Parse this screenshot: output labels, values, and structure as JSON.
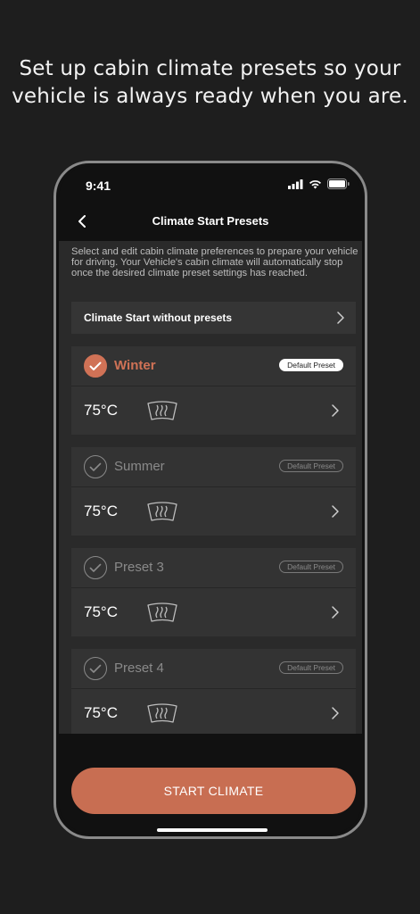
{
  "headline": "Set up cabin climate presets so your vehicle is always ready when you are.",
  "status": {
    "time": "9:41",
    "icons": [
      "signal-icon",
      "wifi-icon",
      "battery-icon"
    ]
  },
  "nav": {
    "title": "Climate Start Presets",
    "back_icon": "chevron-left-icon"
  },
  "intro": "Select and edit cabin climate preferences to prepare your vehicle for driving. Your Vehicle's cabin climate will automatically stop once the desired climate preset settings has reached.",
  "no_presets": {
    "label": "Climate Start without presets"
  },
  "badge_label": "Default Preset",
  "presets": [
    {
      "name": "Winter",
      "temp": "75°C",
      "selected": true
    },
    {
      "name": "Summer",
      "temp": "75°C",
      "selected": false
    },
    {
      "name": "Preset 3",
      "temp": "75°C",
      "selected": false
    },
    {
      "name": "Preset 4",
      "temp": "75°C",
      "selected": false
    }
  ],
  "start_button": "START CLIMATE",
  "colors": {
    "accent": "#c86e52",
    "background": "#1e1e1e",
    "card": "#333333"
  }
}
